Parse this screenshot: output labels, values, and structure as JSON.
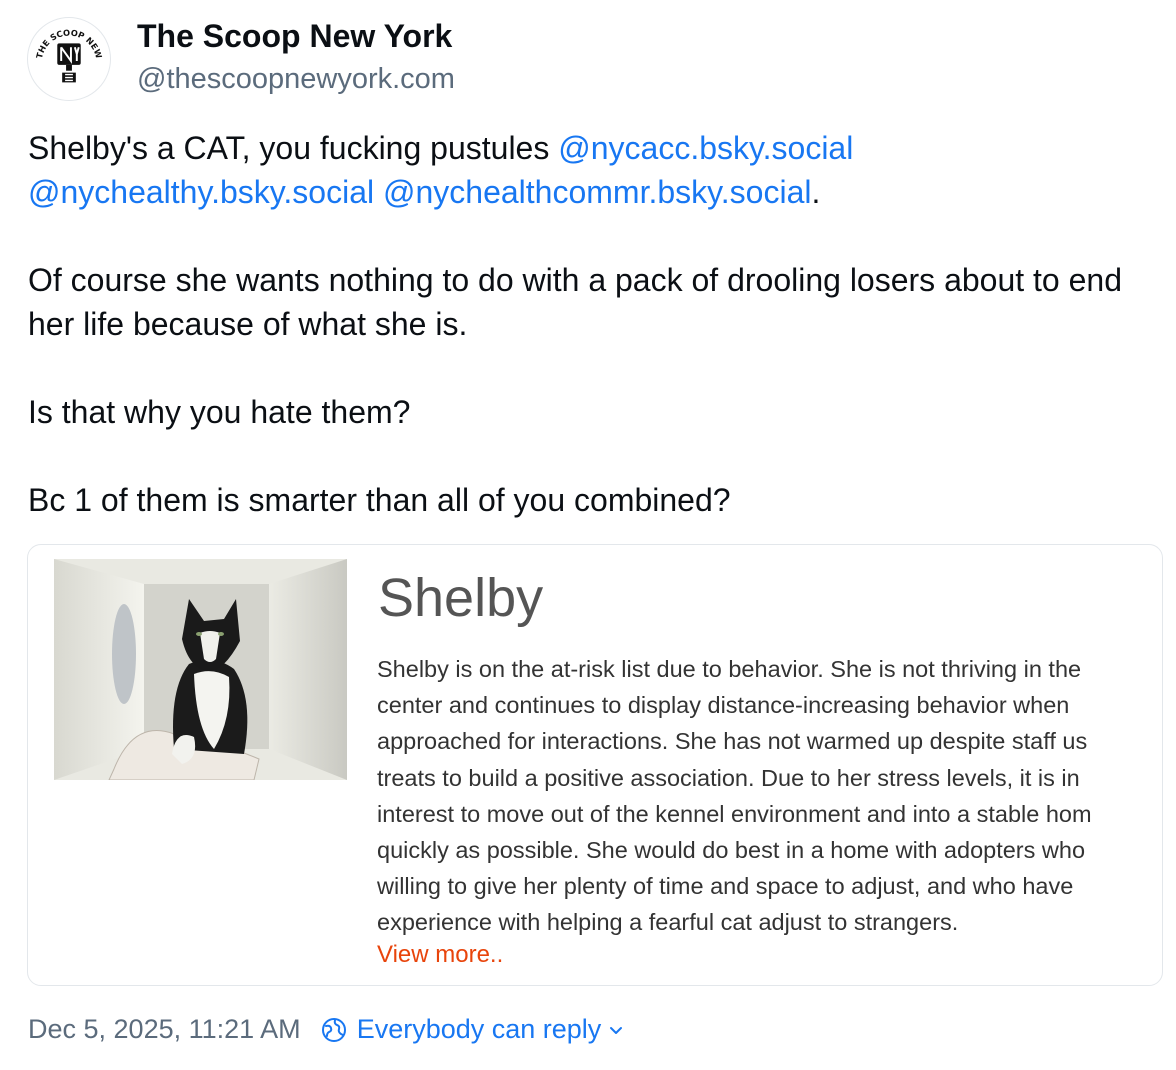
{
  "author": {
    "display_name": "The Scoop New York",
    "handle": "@thescoopnewyork.com",
    "avatar_icon": "the-scoop-new-york-logo"
  },
  "post": {
    "line1_text": "Shelby's a CAT, you fucking pustules ",
    "mention1": "@nycacc.bsky.social",
    "mention2": "@nychealthy.bsky.social",
    "mention3": "@nychealthcommr.bsky.social",
    "line1_end": ".",
    "paragraph2": "Of course she wants nothing to do with a pack of drooling losers about to end her life because of what she is.",
    "paragraph3": "Is that why you hate them?",
    "paragraph4": "Bc 1 of them is smarter than all of you combined?"
  },
  "embed": {
    "title": "Shelby",
    "description_lines": [
      "Shelby is on the at-risk list due to behavior. She is not thriving in the",
      "center and continues to display distance-increasing behavior when",
      "approached for interactions. She has not warmed up despite staff us",
      "treats to build a positive association. Due to her stress levels, it is in",
      "interest to move out of the kennel environment and into a stable hom",
      "quickly as possible. She would do best in a home with adopters who",
      "willing to give her plenty of time and space to adjust, and who have",
      "experience with helping a fearful cat adjust to strangers."
    ],
    "view_more": "View more..",
    "photo_icon": "black-and-white-cat-photo"
  },
  "footer": {
    "timestamp": "Dec 5, 2025, 11:21 AM",
    "reply_setting": "Everybody can reply",
    "reply_icon": "globe-icon",
    "chevron_icon": "chevron-down-icon"
  },
  "colors": {
    "link": "#1877f2",
    "muted": "#5b6b7c",
    "view_more": "#e8440b",
    "card_title": "#555555"
  }
}
